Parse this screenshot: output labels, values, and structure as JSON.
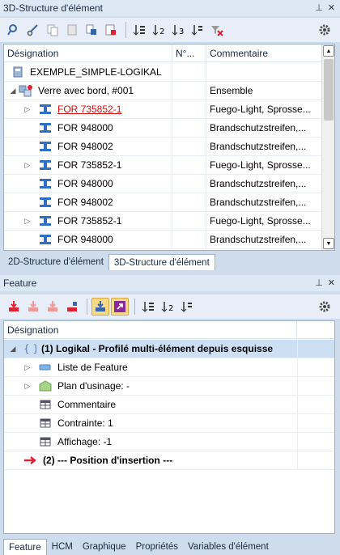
{
  "top_panel": {
    "title": "3D-Structure d'élément",
    "pin": "⊥",
    "close": "✕",
    "columns": [
      "Désignation",
      "N°...",
      "Commentaire"
    ],
    "rows": [
      {
        "name": "EXEMPLE_SIMPLE-LOGIKAL",
        "comment": "",
        "icon": "assembly-root-icon",
        "indent": 0,
        "expand": ""
      },
      {
        "name": "Verre avec bord, #001",
        "comment": "Ensemble",
        "icon": "assembly-icon",
        "indent": 0,
        "expand": "◢"
      },
      {
        "name": "FOR 735852-1",
        "comment": "Fuego-Light, Sprosse...",
        "icon": "profile-icon",
        "indent": 1,
        "expand": "▷",
        "red": true
      },
      {
        "name": "FOR 948000",
        "comment": "Brandschutzstreifen,...",
        "icon": "profile-icon",
        "indent": 1,
        "expand": ""
      },
      {
        "name": "FOR 948002",
        "comment": "Brandschutzstreifen,...",
        "icon": "profile-icon",
        "indent": 1,
        "expand": ""
      },
      {
        "name": "FOR 735852-1",
        "comment": "Fuego-Light, Sprosse...",
        "icon": "profile-icon",
        "indent": 1,
        "expand": "▷"
      },
      {
        "name": "FOR 948000",
        "comment": "Brandschutzstreifen,...",
        "icon": "profile-icon",
        "indent": 1,
        "expand": ""
      },
      {
        "name": "FOR 948002",
        "comment": "Brandschutzstreifen,...",
        "icon": "profile-icon",
        "indent": 1,
        "expand": ""
      },
      {
        "name": "FOR 735852-1",
        "comment": "Fuego-Light, Sprosse...",
        "icon": "profile-icon",
        "indent": 1,
        "expand": "▷"
      },
      {
        "name": "FOR 948000",
        "comment": "Brandschutzstreifen,...",
        "icon": "profile-icon",
        "indent": 1,
        "expand": ""
      }
    ],
    "tabs": [
      "2D-Structure d'élément",
      "3D-Structure d'élément"
    ]
  },
  "feature_panel": {
    "title": "Feature",
    "pin": "⊥",
    "close": "✕",
    "column": "Désignation",
    "rows": [
      {
        "label": "(1) Logikal - Profilé multi-élément depuis esquisse",
        "icon": "braces-icon",
        "expand": "◢",
        "bold": true,
        "selected": true
      },
      {
        "label": "Liste de Feature",
        "icon": "feature-list-icon",
        "expand": "▷"
      },
      {
        "label": "Plan d'usinage: -",
        "icon": "machining-plane-icon",
        "expand": "▷"
      },
      {
        "label": "Commentaire",
        "icon": "table-icon",
        "expand": ""
      },
      {
        "label": "Contrainte: 1",
        "icon": "table-icon",
        "expand": ""
      },
      {
        "label": "Affichage: -1",
        "icon": "table-icon",
        "expand": ""
      },
      {
        "label": "(2) --- Position  d'insertion ---",
        "icon": "red-arrow-icon",
        "expand": "",
        "bold": true
      }
    ],
    "tabs": [
      "Feature",
      "HCM",
      "Graphique",
      "Propriétés",
      "Variables d'élément"
    ]
  },
  "colors": {
    "accent": "#f7d98a",
    "link_red": "#d01010",
    "selection": "#ccdff3"
  }
}
